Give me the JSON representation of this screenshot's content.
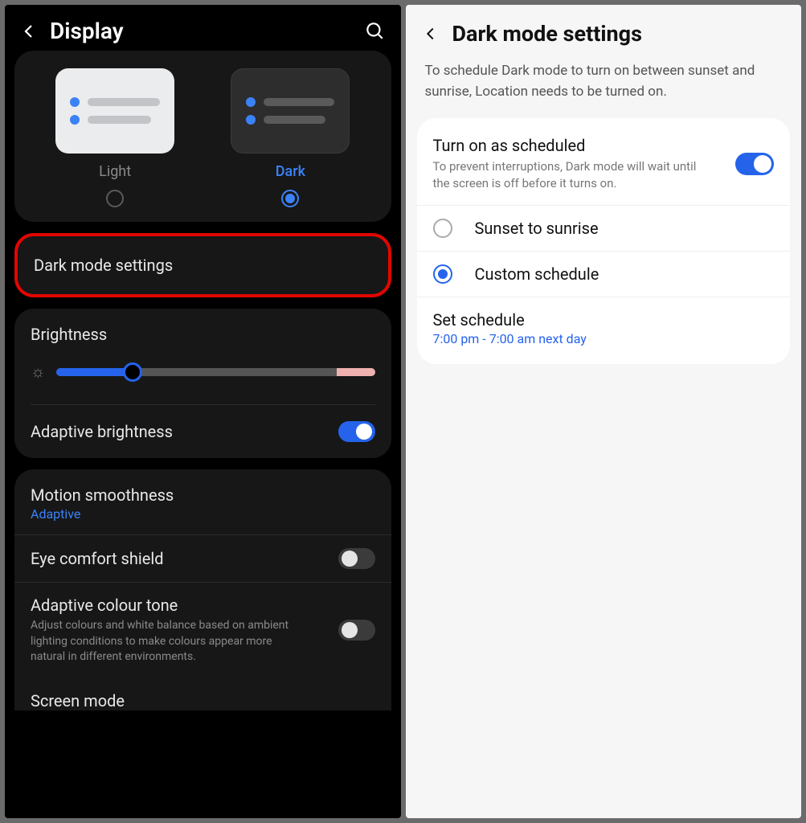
{
  "left": {
    "title": "Display",
    "theme": {
      "light_label": "Light",
      "dark_label": "Dark"
    },
    "dark_mode_settings": "Dark mode settings",
    "brightness": {
      "title": "Brightness",
      "adaptive_label": "Adaptive brightness"
    },
    "motion": {
      "title": "Motion smoothness",
      "value": "Adaptive"
    },
    "eye_comfort": "Eye comfort shield",
    "adaptive_colour": {
      "title": "Adaptive colour tone",
      "desc": "Adjust colours and white balance based on ambient lighting conditions to make colours appear more natural in different environments."
    },
    "screen_mode": "Screen mode"
  },
  "right": {
    "title": "Dark mode settings",
    "subtitle": "To schedule Dark mode to turn on between sunset and sunrise, Location needs to be turned on.",
    "scheduled": {
      "title": "Turn on as scheduled",
      "desc": "To prevent interruptions, Dark mode will wait until the screen is off before it turns on."
    },
    "sunset": "Sunset to sunrise",
    "custom": "Custom schedule",
    "set_schedule": {
      "title": "Set schedule",
      "value": "7:00 pm - 7:00 am next day"
    }
  }
}
